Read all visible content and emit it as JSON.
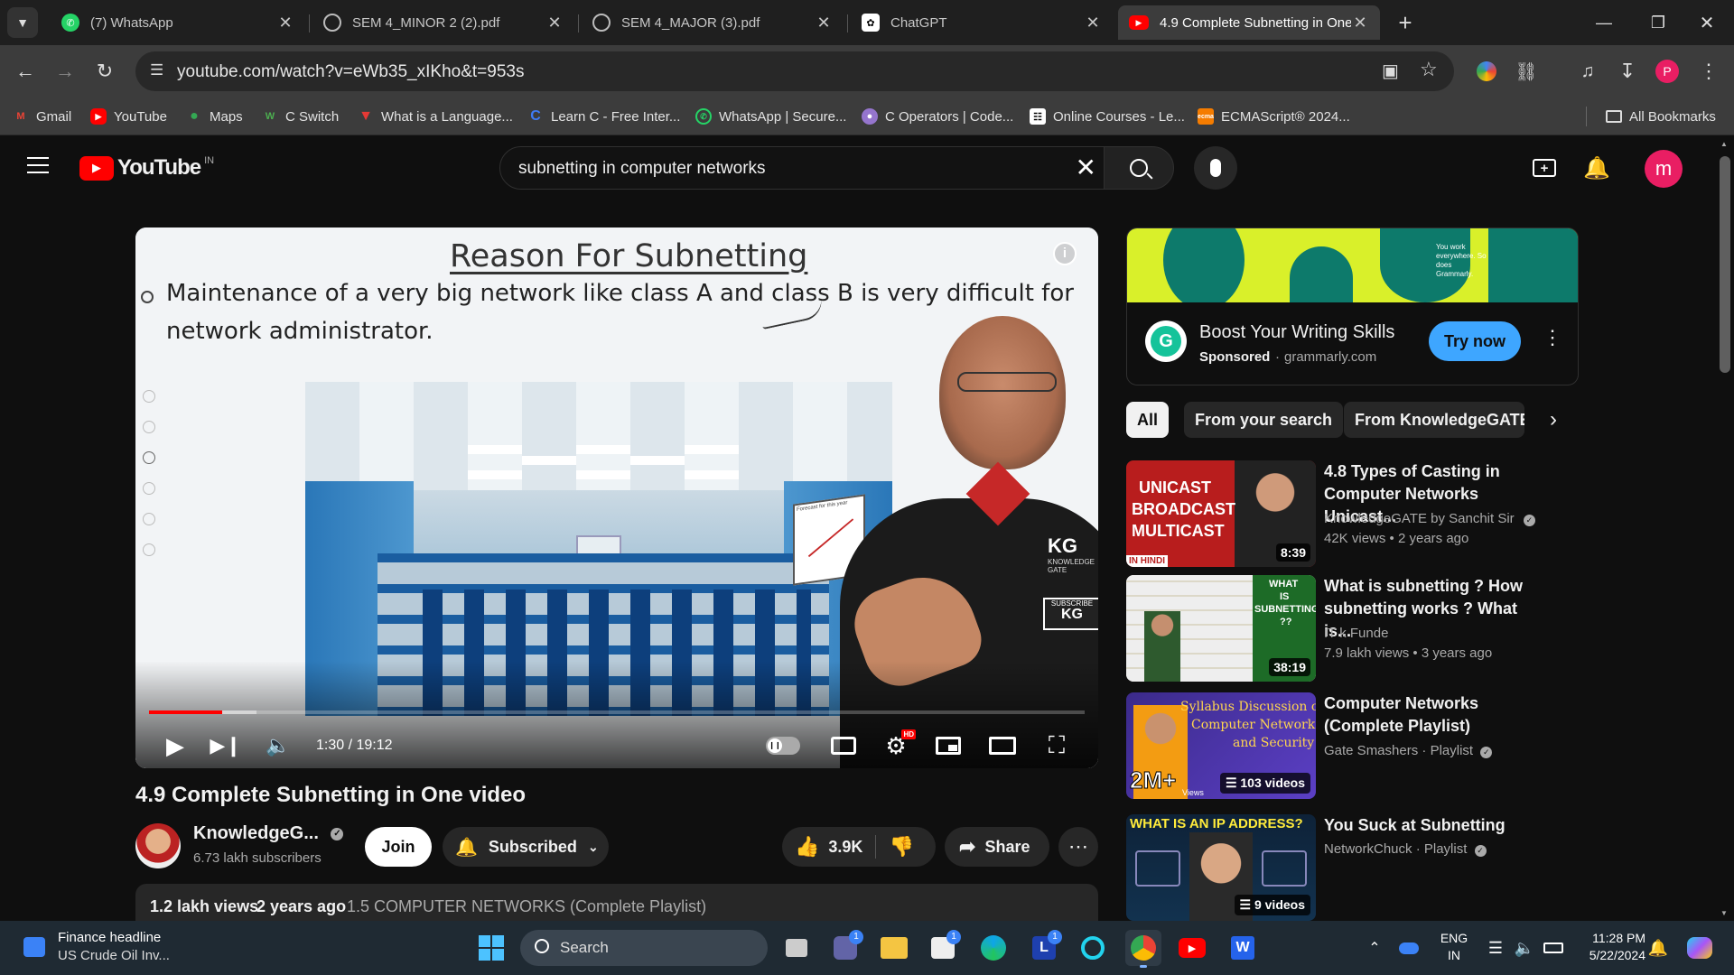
{
  "tabs": [
    {
      "label": "(7) WhatsApp",
      "icon": "whatsapp-icon"
    },
    {
      "label": "SEM 4_MINOR 2 (2).pdf",
      "icon": "globe-icon"
    },
    {
      "label": "SEM 4_MAJOR (3).pdf",
      "icon": "globe-icon"
    },
    {
      "label": "ChatGPT",
      "icon": "chatgpt-icon"
    },
    {
      "label": "4.9 Complete Subnetting in One",
      "icon": "youtube-icon"
    }
  ],
  "address_bar": {
    "url": "youtube.com/watch?v=eWb35_xIKho&t=953s"
  },
  "bookmarks": [
    {
      "label": "Gmail"
    },
    {
      "label": "YouTube"
    },
    {
      "label": "Maps"
    },
    {
      "label": "C Switch"
    },
    {
      "label": "What is a Language..."
    },
    {
      "label": "Learn C - Free Inter..."
    },
    {
      "label": "WhatsApp | Secure..."
    },
    {
      "label": "C Operators | Code..."
    },
    {
      "label": "Online Courses - Le..."
    },
    {
      "label": "ECMAScript® 2024..."
    }
  ],
  "all_bookmarks_label": "All Bookmarks",
  "youtube": {
    "logo_text": "YouTube",
    "region": "IN",
    "search_query": "subnetting in computer networks",
    "avatar_letter": "m"
  },
  "slide": {
    "title": "Reason For Subnetting",
    "bullet_line1": "Maintenance of a very big network like class A and class B is very difficult for",
    "bullet_line2": "network administrator.",
    "chart_caption": "Forecast for this year",
    "watermark_kg": "KG",
    "watermark_sub": "KNOWLEDGE GATE",
    "subscribe_label": "SUBSCRIBE"
  },
  "player": {
    "time": "1:30 / 19:12",
    "progress": 0.078,
    "buffered": 0.115,
    "hd_badge": "HD"
  },
  "video": {
    "title": "4.9 Complete Subnetting in One video",
    "channel": "KnowledgeG...",
    "subscribers": "6.73 lakh subscribers",
    "join_label": "Join",
    "subscribed_label": "Subscribed",
    "likes": "3.9K",
    "share_label": "Share",
    "views": "1.2 lakh views",
    "age": "2 years ago",
    "playlist": "1.5 COMPUTER NETWORKS (Complete Playlist)"
  },
  "ad": {
    "banner_text": "You work everywhere. So does Grammarly.",
    "title": "Boost Your Writing Skills",
    "sponsored": "Sponsored",
    "domain": "grammarly.com",
    "cta": "Try now"
  },
  "chips": [
    "All",
    "From your search",
    "From KnowledgeGATE"
  ],
  "recommendations": [
    {
      "title": "4.8 Types of Casting in Computer Networks Unicast...",
      "channel": "KnowledgeGATE by Sanchit Sir",
      "views": "42K views",
      "age": "2 years ago",
      "duration": "8:39",
      "thumb_lines": [
        "UNICAST",
        "BROADCAST",
        "MULTICAST"
      ],
      "thumb_tag": "IN HINDI"
    },
    {
      "title": "What is subnetting ? How subnetting works ? What is...",
      "channel": "IT k Funde",
      "views": "7.9 lakh views",
      "age": "3 years ago",
      "duration": "38:19",
      "thumb_lines": [
        "WHAT",
        "IS",
        "SUBNETTING",
        "??"
      ]
    },
    {
      "title": "Computer Networks (Complete Playlist)",
      "channel": "Gate Smashers",
      "meta": "Playlist",
      "count": "103 videos",
      "thumb_lines": [
        "Syllabus Discussion of",
        "Computer Networks",
        "and Security"
      ],
      "thumb_big": "2M+",
      "thumb_small": "Views"
    },
    {
      "title": "You Suck at Subnetting",
      "channel": "NetworkChuck",
      "meta": "Playlist",
      "count": "9 videos",
      "thumb_lines": [
        "WHAT IS AN IP ADDRESS?"
      ]
    }
  ],
  "taskbar": {
    "news_title": "Finance headline",
    "news_sub": "US Crude Oil Inv...",
    "search_label": "Search",
    "lang": "ENG",
    "lang_region": "IN",
    "time": "11:28 PM",
    "date": "5/22/2024",
    "badge_teams": "1",
    "badge_store": "1",
    "badge_l": "1"
  },
  "colors": {
    "accent_red": "#ff0000",
    "ad_green": "#d9f02a",
    "ad_teal": "#0d7a6b",
    "try_now_blue": "#3ea6ff"
  }
}
